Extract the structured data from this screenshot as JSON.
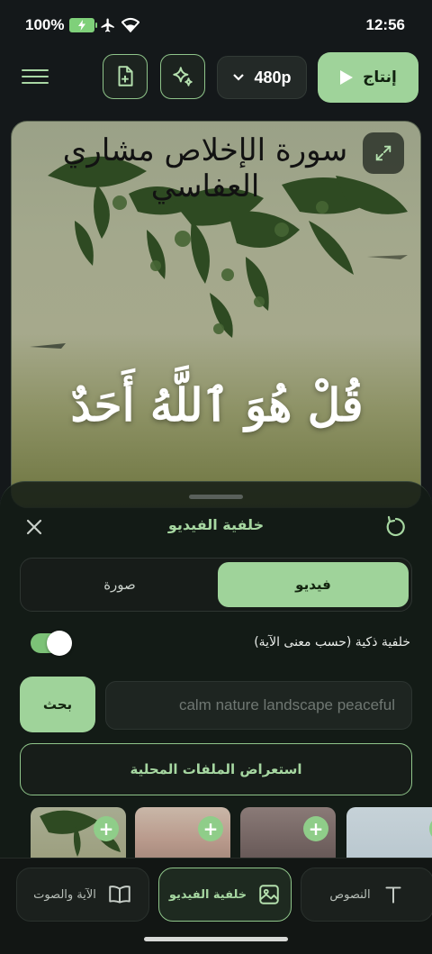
{
  "status_bar": {
    "battery": "100%",
    "time": "12:56"
  },
  "toolbar": {
    "resolution": "480p",
    "export_label": "إنتاج"
  },
  "preview": {
    "surah_caption": "سورة الإخلاص  مشاري العفاسي",
    "ayah_text": "قُلْ هُوَ ٱللَّهُ أَحَدٌ"
  },
  "sheet": {
    "title": "خلفية الفيديو",
    "tabs": {
      "video": "فيديو",
      "image": "صورة"
    },
    "smart_background_label": "خلفية ذكية (حسب معنى الآية)",
    "smart_background_on": true,
    "search_button": "بحث",
    "search_value": "calm nature landscape peaceful",
    "browse_local": "استعراض الملفات المحلية",
    "thumb_add": "+"
  },
  "nav": {
    "items": [
      {
        "label": "النصوص",
        "icon": "text-icon"
      },
      {
        "label": "خلفية الفيديو",
        "icon": "image-icon"
      },
      {
        "label": "الآية والصوت",
        "icon": "book-icon"
      }
    ],
    "active": "خلفية الفيديو"
  },
  "colors": {
    "accent": "#9fd39a",
    "background": "#14181a"
  }
}
